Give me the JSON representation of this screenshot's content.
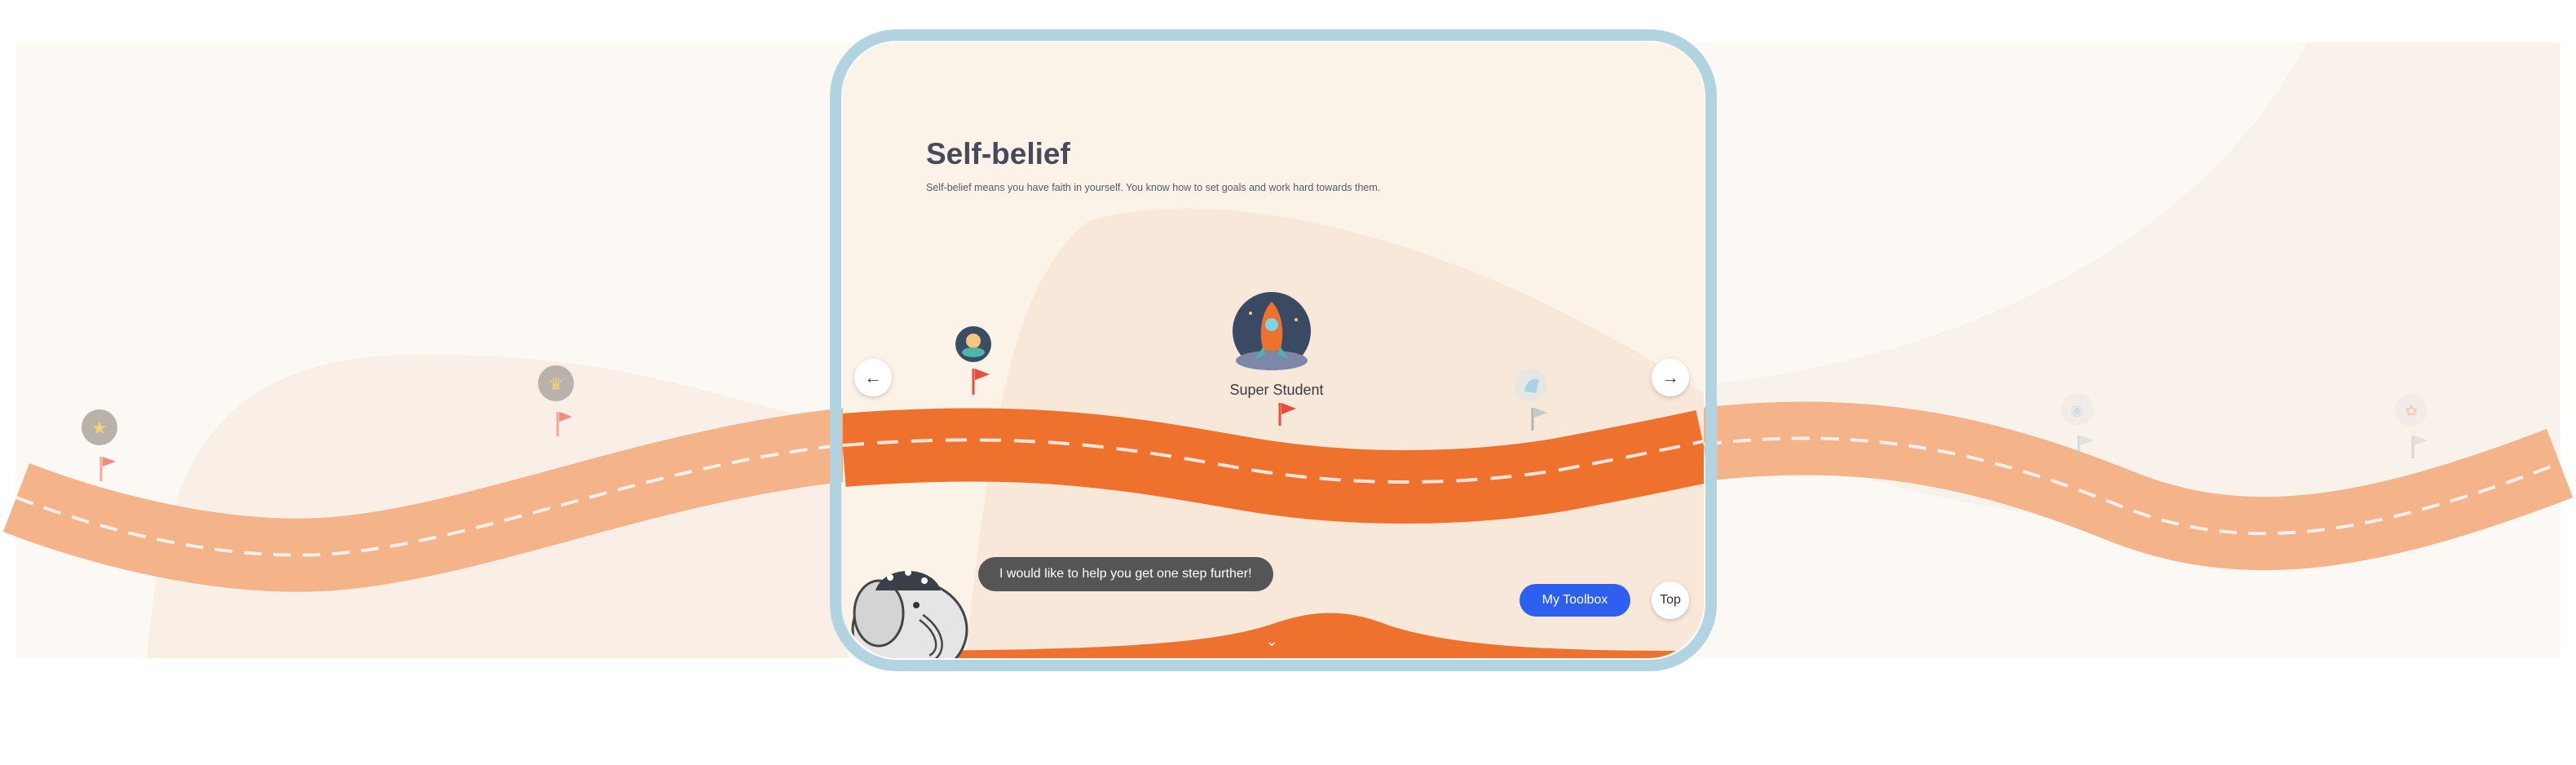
{
  "section": {
    "title": "Self-belief",
    "description": "Self-belief means you have faith in yourself. You know how to set goals and work hard towards them."
  },
  "milestones": [
    {
      "name": "star-badge-icon",
      "status": "faded"
    },
    {
      "name": "trophy-badge-icon",
      "status": "faded"
    },
    {
      "name": "astronaut-badge-icon",
      "status": "active"
    },
    {
      "name": "rocket-badge-icon",
      "status": "current",
      "label": "Super Student"
    },
    {
      "name": "unicorn-badge-icon",
      "status": "locked"
    },
    {
      "name": "lightbulb-badge-icon",
      "status": "locked"
    },
    {
      "name": "flower-badge-icon",
      "status": "locked"
    }
  ],
  "mascot": {
    "name": "elephant",
    "message": "I would like to help you get one step further!"
  },
  "buttons": {
    "prev": "←",
    "next": "→",
    "toolbox": "My Toolbox",
    "top": "Top",
    "scroll_down": "⌄"
  },
  "colors": {
    "road_active": "#ee722d",
    "road_faded": "#f4b389",
    "frame_border": "#b2d4e0",
    "toolbox_button": "#2e60f0",
    "flag_red": "#e84e3c"
  }
}
